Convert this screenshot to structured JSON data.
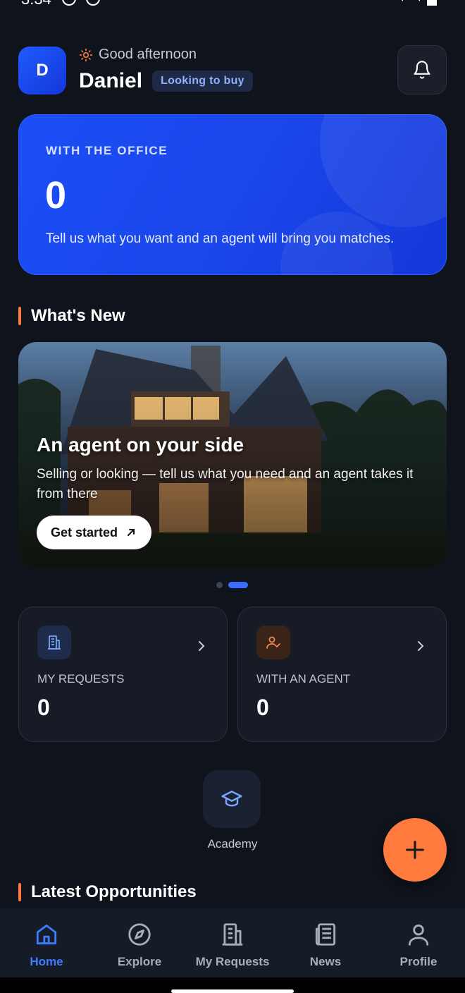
{
  "status_bar": {
    "time": "3:34"
  },
  "header": {
    "avatar_initial": "D",
    "greeting": "Good afternoon",
    "name": "Daniel",
    "badge": "Looking to buy"
  },
  "hero": {
    "label": "WITH THE OFFICE",
    "count": "0",
    "description": "Tell us what you want and an agent will bring you matches."
  },
  "whats_new": {
    "title": "What's New",
    "banner": {
      "title": "An agent on your side",
      "description": "Selling or looking — tell us what you need and an agent takes it from there",
      "cta": "Get started",
      "cta_icon": "arrow-up-right-icon"
    },
    "pager": {
      "pages": 2,
      "active_index": 1
    }
  },
  "stats": [
    {
      "label": "MY REQUESTS",
      "value": "0",
      "icon": "building-icon",
      "color": "#1e2b4a"
    },
    {
      "label": "WITH AN AGENT",
      "value": "0",
      "icon": "user-check-icon",
      "color": "#3a2418"
    }
  ],
  "academy": {
    "label": "Academy",
    "icon": "graduation-cap-icon"
  },
  "latest": {
    "title": "Latest Opportunities"
  },
  "fab": {
    "icon": "plus-icon",
    "color": "#ff7a3d"
  },
  "bottom_nav": {
    "items": [
      {
        "label": "Home",
        "icon": "home-icon",
        "active": true
      },
      {
        "label": "Explore",
        "icon": "compass-icon",
        "active": false
      },
      {
        "label": "My Requests",
        "icon": "building-icon",
        "active": false
      },
      {
        "label": "News",
        "icon": "newspaper-icon",
        "active": false
      },
      {
        "label": "Profile",
        "icon": "user-icon",
        "active": false
      }
    ]
  },
  "colors": {
    "accent": "#3d7bff",
    "orange": "#ff7a3d",
    "background": "#0f131b"
  }
}
